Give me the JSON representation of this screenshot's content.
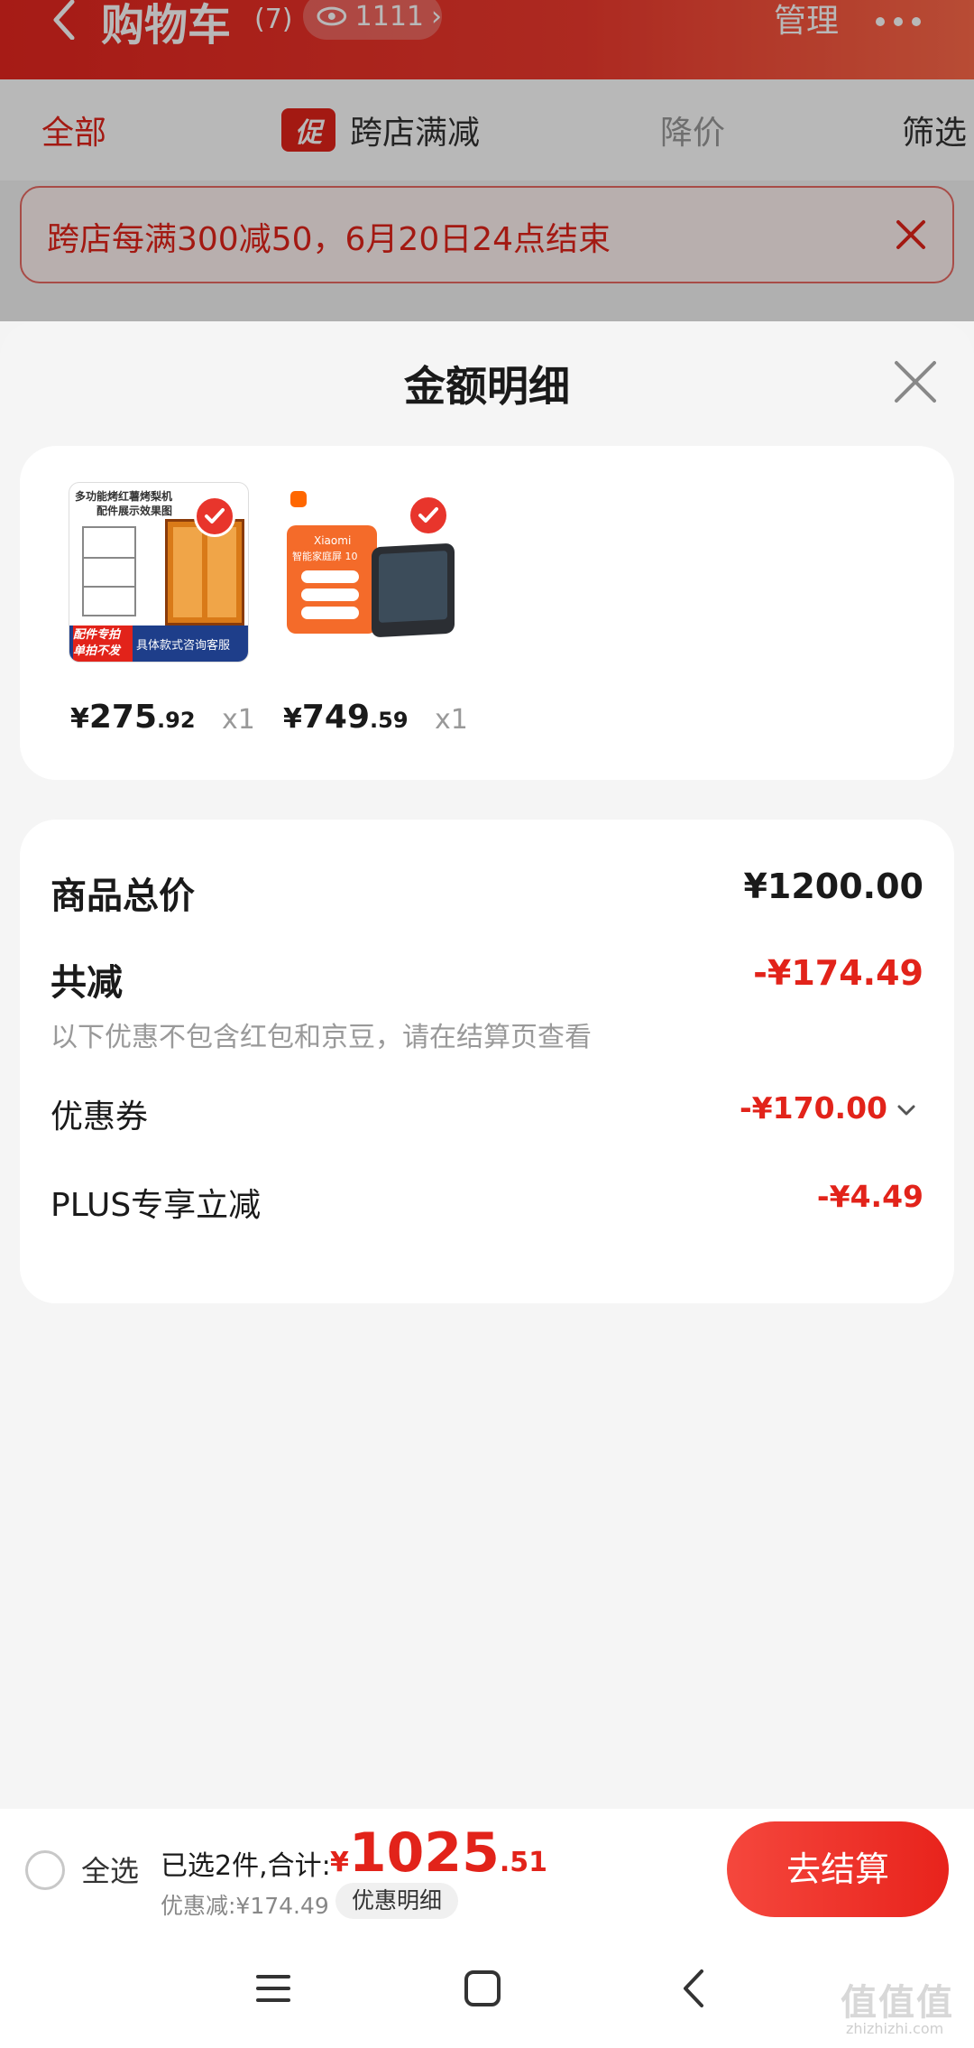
{
  "header": {
    "title": "购物车",
    "count": "(7)",
    "views": "1111",
    "manage": "管理"
  },
  "filters": {
    "all": "全部",
    "promo_tag": "促",
    "cross_store": "跨店满减",
    "price_drop": "降价",
    "filter": "筛选"
  },
  "banner": {
    "text": "跨店每满300减50，6月20日24点结束"
  },
  "sheet": {
    "title": "金额明细",
    "items": [
      {
        "price_yen": "¥",
        "price_int": "275",
        "price_dec": ".92",
        "qty": "x1",
        "thumb_text_1": "多功能烤红薯烤梨机",
        "thumb_text_2": "配件展示效果图",
        "thumb_tag": "配件专拍 单拍不发",
        "thumb_service": "具体款式咨询客服"
      },
      {
        "price_yen": "¥",
        "price_int": "749",
        "price_dec": ".59",
        "qty": "x1",
        "thumb_brand": "Xiaomi",
        "thumb_name": "智能家庭屏 10"
      }
    ],
    "summary": {
      "total_label": "商品总价",
      "total_value": "¥1200.00",
      "discount_label": "共减",
      "discount_value": "-¥174.49",
      "note": "以下优惠不包含红包和京豆，请在结算页查看",
      "coupon_label": "优惠券",
      "coupon_value": "-¥170.00",
      "plus_label": "PLUS专享立减",
      "plus_value": "-¥4.49"
    }
  },
  "checkout": {
    "select_all": "全选",
    "selected": "已选2件,合计:",
    "total_yen": "¥",
    "total_int": "1025",
    "total_dec": ".51",
    "saved": "优惠减:¥174.49",
    "detail_button": "优惠明细",
    "checkout_button": "去结算"
  },
  "watermark": {
    "mark": "值值值",
    "url": "zhizhizhi.com"
  },
  "colors": {
    "brand_red": "#e2231a",
    "sheet_bg": "#f5f5f5"
  }
}
